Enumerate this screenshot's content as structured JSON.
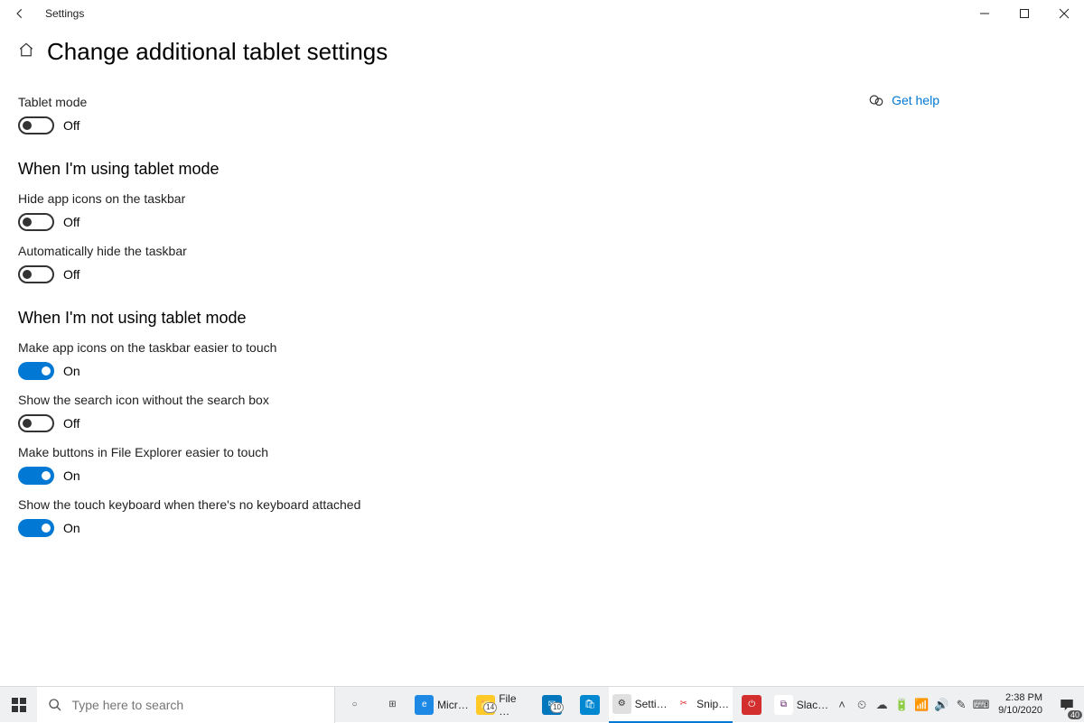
{
  "titlebar": {
    "title": "Settings"
  },
  "header": {
    "page_title": "Change additional tablet settings"
  },
  "help": {
    "label": "Get help"
  },
  "labels": {
    "on": "On",
    "off": "Off"
  },
  "settings": {
    "tablet_mode": {
      "label": "Tablet mode",
      "state": "off"
    },
    "section_using": {
      "heading": "When I'm using tablet mode"
    },
    "hide_icons": {
      "label": "Hide app icons on the taskbar",
      "state": "off"
    },
    "hide_taskbar": {
      "label": "Automatically hide the taskbar",
      "state": "off"
    },
    "section_not_using": {
      "heading": "When I'm not using tablet mode"
    },
    "easier_icons": {
      "label": "Make app icons on the taskbar easier to touch",
      "state": "on"
    },
    "search_icon_only": {
      "label": "Show the search icon without the search box",
      "state": "off"
    },
    "easier_explorer": {
      "label": "Make buttons in File Explorer easier to touch",
      "state": "on"
    },
    "touch_keyboard": {
      "label": "Show the touch keyboard when there's no keyboard attached",
      "state": "on"
    }
  },
  "taskbar": {
    "search_placeholder": "Type here to search",
    "apps": [
      {
        "name": "cortana",
        "label": "",
        "glyph": "○",
        "bg": "transparent",
        "fg": "#444"
      },
      {
        "name": "task-view",
        "label": "",
        "glyph": "⊞",
        "bg": "transparent",
        "fg": "#444"
      },
      {
        "name": "edge",
        "label": "Micr…",
        "glyph": "e",
        "bg": "#1e88e5"
      },
      {
        "name": "file-explorer",
        "label": "File …",
        "glyph": "📁",
        "bg": "#ffca28",
        "badge": "14"
      },
      {
        "name": "mail",
        "label": "",
        "glyph": "✉",
        "bg": "#0277bd",
        "badge": "10"
      },
      {
        "name": "store",
        "label": "",
        "glyph": "🛍",
        "bg": "#0288d1"
      },
      {
        "name": "settings",
        "label": "Setti…",
        "glyph": "⚙",
        "bg": "#e0e0e0",
        "fg": "#333",
        "active": true
      },
      {
        "name": "snip",
        "label": "Snip…",
        "glyph": "✂",
        "bg": "#ffffff",
        "fg": "#d33",
        "active": true
      },
      {
        "name": "power",
        "label": "",
        "glyph": "⏻",
        "bg": "#d32f2f"
      },
      {
        "name": "slack",
        "label": "Slac…",
        "glyph": "⧉",
        "bg": "#ffffff",
        "fg": "#611f69"
      }
    ],
    "tray_icons": [
      "˄",
      "⏲",
      "☁",
      "🔋",
      "📶",
      "🔊",
      "✎",
      "⌨"
    ],
    "clock": {
      "time": "2:38 PM",
      "date": "9/10/2020"
    },
    "action_badge": "40"
  }
}
